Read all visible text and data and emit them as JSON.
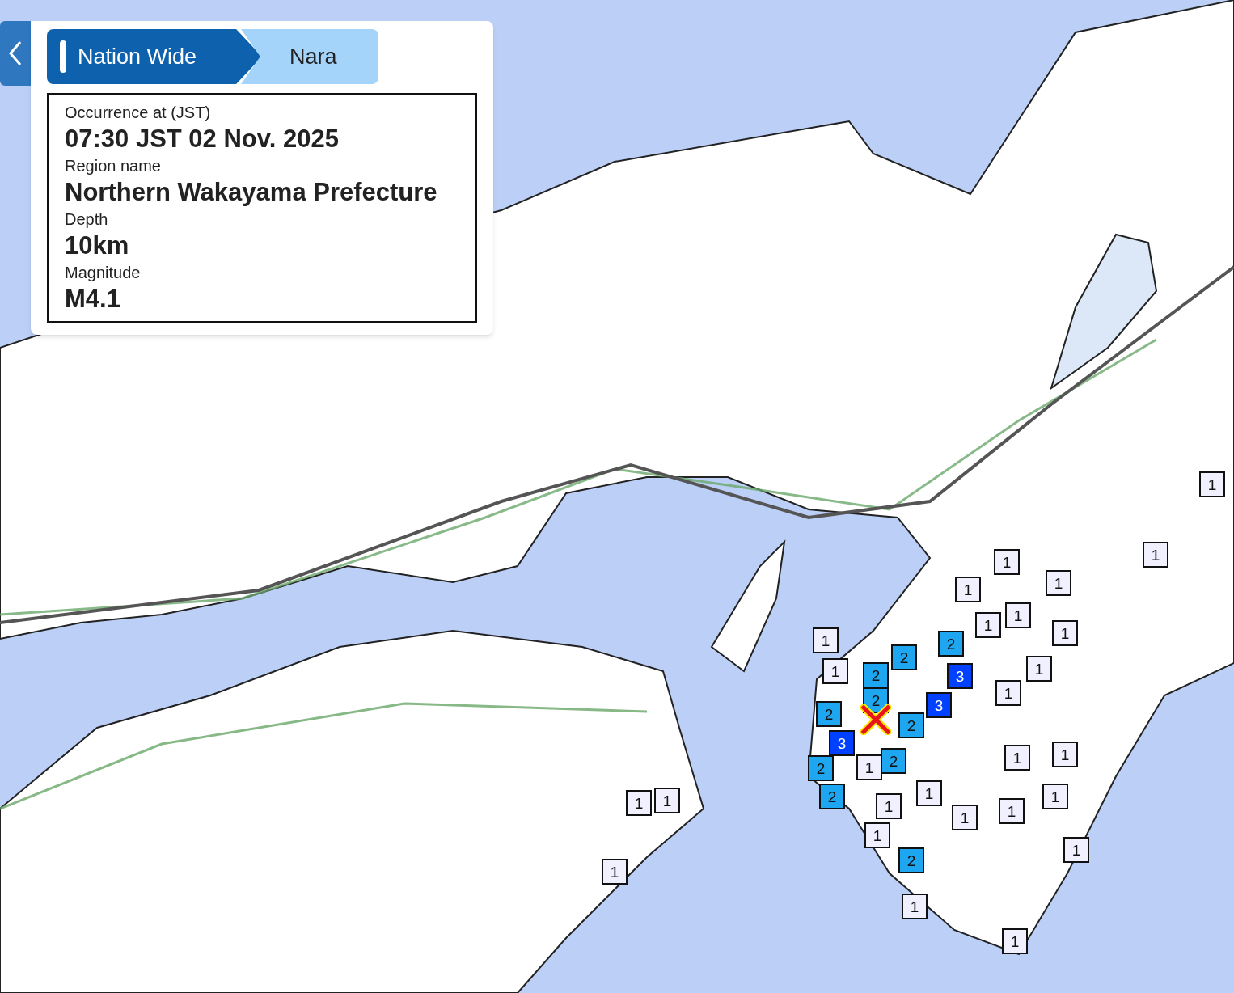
{
  "breadcrumb": [
    {
      "label": "Nation Wide",
      "selected": true
    },
    {
      "label": "Nara",
      "selected": false
    }
  ],
  "event": [
    {
      "label": "Occurrence at (JST)",
      "value": "07:30 JST 02 Nov. 2025"
    },
    {
      "label": "Region name",
      "value": "Northern Wakayama Prefecture"
    },
    {
      "label": "Depth",
      "value": "10km"
    },
    {
      "label": "Magnitude",
      "value": "M4.1"
    }
  ],
  "markers": [
    {
      "text": "1",
      "color": "#f0f0ff"
    },
    {
      "text": "1",
      "color": "#f0f0ff"
    },
    {
      "text": "1",
      "color": "#f0f0ff"
    },
    {
      "text": "1",
      "color": "#f0f0ff"
    },
    {
      "text": "1",
      "color": "#f0f0ff"
    },
    {
      "text": "1",
      "color": "#f0f0ff"
    },
    {
      "text": "1",
      "color": "#f0f0ff"
    },
    {
      "text": "1",
      "color": "#f0f0ff"
    },
    {
      "text": "1",
      "color": "#f0f0ff"
    },
    {
      "text": "1",
      "color": "#f0f0ff"
    },
    {
      "text": "1",
      "color": "#f0f0ff"
    },
    {
      "text": "1",
      "color": "#f0f0ff"
    },
    {
      "text": "1",
      "color": "#f0f0ff"
    },
    {
      "text": "1",
      "color": "#f0f0ff"
    },
    {
      "text": "1",
      "color": "#f0f0ff"
    },
    {
      "text": "1",
      "color": "#f0f0ff"
    },
    {
      "text": "1",
      "color": "#f0f0ff"
    },
    {
      "text": "1",
      "color": "#f0f0ff"
    },
    {
      "text": "1",
      "color": "#f0f0ff"
    },
    {
      "text": "1",
      "color": "#f0f0ff"
    },
    {
      "text": "1",
      "color": "#f0f0ff"
    },
    {
      "text": "1",
      "color": "#f0f0ff"
    },
    {
      "text": "1",
      "color": "#f0f0ff"
    },
    {
      "text": "1",
      "color": "#f0f0ff"
    },
    {
      "text": "1",
      "color": "#f0f0ff"
    },
    {
      "text": "1",
      "color": "#f0f0ff"
    },
    {
      "text": "1",
      "color": "#f0f0ff"
    },
    {
      "text": "2",
      "color": "#1ea7f0"
    },
    {
      "text": "2",
      "color": "#1ea7f0"
    },
    {
      "text": "2",
      "color": "#1ea7f0"
    },
    {
      "text": "2",
      "color": "#1ea7f0"
    },
    {
      "text": "2",
      "color": "#1ea7f0"
    },
    {
      "text": "2",
      "color": "#1ea7f0"
    },
    {
      "text": "2",
      "color": "#1ea7f0"
    },
    {
      "text": "2",
      "color": "#1ea7f0"
    },
    {
      "text": "2",
      "color": "#1ea7f0"
    },
    {
      "text": "2",
      "color": "#1ea7f0"
    },
    {
      "text": "3",
      "color": "#0041ff"
    },
    {
      "text": "3",
      "color": "#0041ff"
    },
    {
      "text": "3",
      "color": "#0041ff"
    }
  ]
}
